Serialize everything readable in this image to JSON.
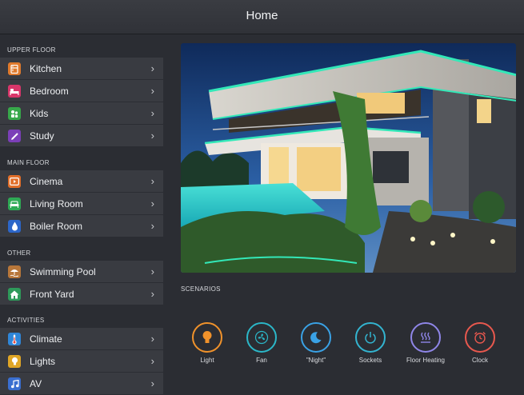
{
  "header": {
    "title": "Home"
  },
  "sidebar": {
    "sections": [
      {
        "title": "UPPER FLOOR",
        "items": [
          {
            "label": "Kitchen",
            "icon": "kitchen-icon",
            "color": "#e07a2c"
          },
          {
            "label": "Bedroom",
            "icon": "bed-icon",
            "color": "#d8366a"
          },
          {
            "label": "Kids",
            "icon": "kids-icon",
            "color": "#37a84a"
          },
          {
            "label": "Study",
            "icon": "pencil-icon",
            "color": "#7b3fb8"
          }
        ]
      },
      {
        "title": "MAIN FLOOR",
        "items": [
          {
            "label": "Cinema",
            "icon": "play-icon",
            "color": "#e26f2a"
          },
          {
            "label": "Living Room",
            "icon": "sofa-icon",
            "color": "#2faa55"
          },
          {
            "label": "Boiler Room",
            "icon": "drop-icon",
            "color": "#2c66c9"
          }
        ]
      },
      {
        "title": "OTHER",
        "items": [
          {
            "label": "Swimming Pool",
            "icon": "pool-icon",
            "color": "#b8773a"
          },
          {
            "label": "Front Yard",
            "icon": "house-icon",
            "color": "#2e9a5a"
          }
        ]
      },
      {
        "title": "ACTIVITIES",
        "items": [
          {
            "label": "Climate",
            "icon": "thermometer-icon",
            "color": "#2f86d8"
          },
          {
            "label": "Lights",
            "icon": "bulb-icon",
            "color": "#e0a626"
          },
          {
            "label": "AV",
            "icon": "music-icon",
            "color": "#3a6fd0"
          }
        ]
      }
    ]
  },
  "scenarios": {
    "title": "SCENARIOS",
    "items": [
      {
        "label": "Light",
        "icon": "bulb-icon",
        "color": "#f0922b"
      },
      {
        "label": "Fan",
        "icon": "fan-icon",
        "color": "#2bb7c8"
      },
      {
        "label": "\"Night\"",
        "icon": "moon-icon",
        "color": "#3aa2e6"
      },
      {
        "label": "Sockets",
        "icon": "power-icon",
        "color": "#33b4d0"
      },
      {
        "label": "Floor Heating",
        "icon": "heat-icon",
        "color": "#8f86e8"
      },
      {
        "label": "Clock",
        "icon": "clock-icon",
        "color": "#e8584e"
      }
    ]
  }
}
